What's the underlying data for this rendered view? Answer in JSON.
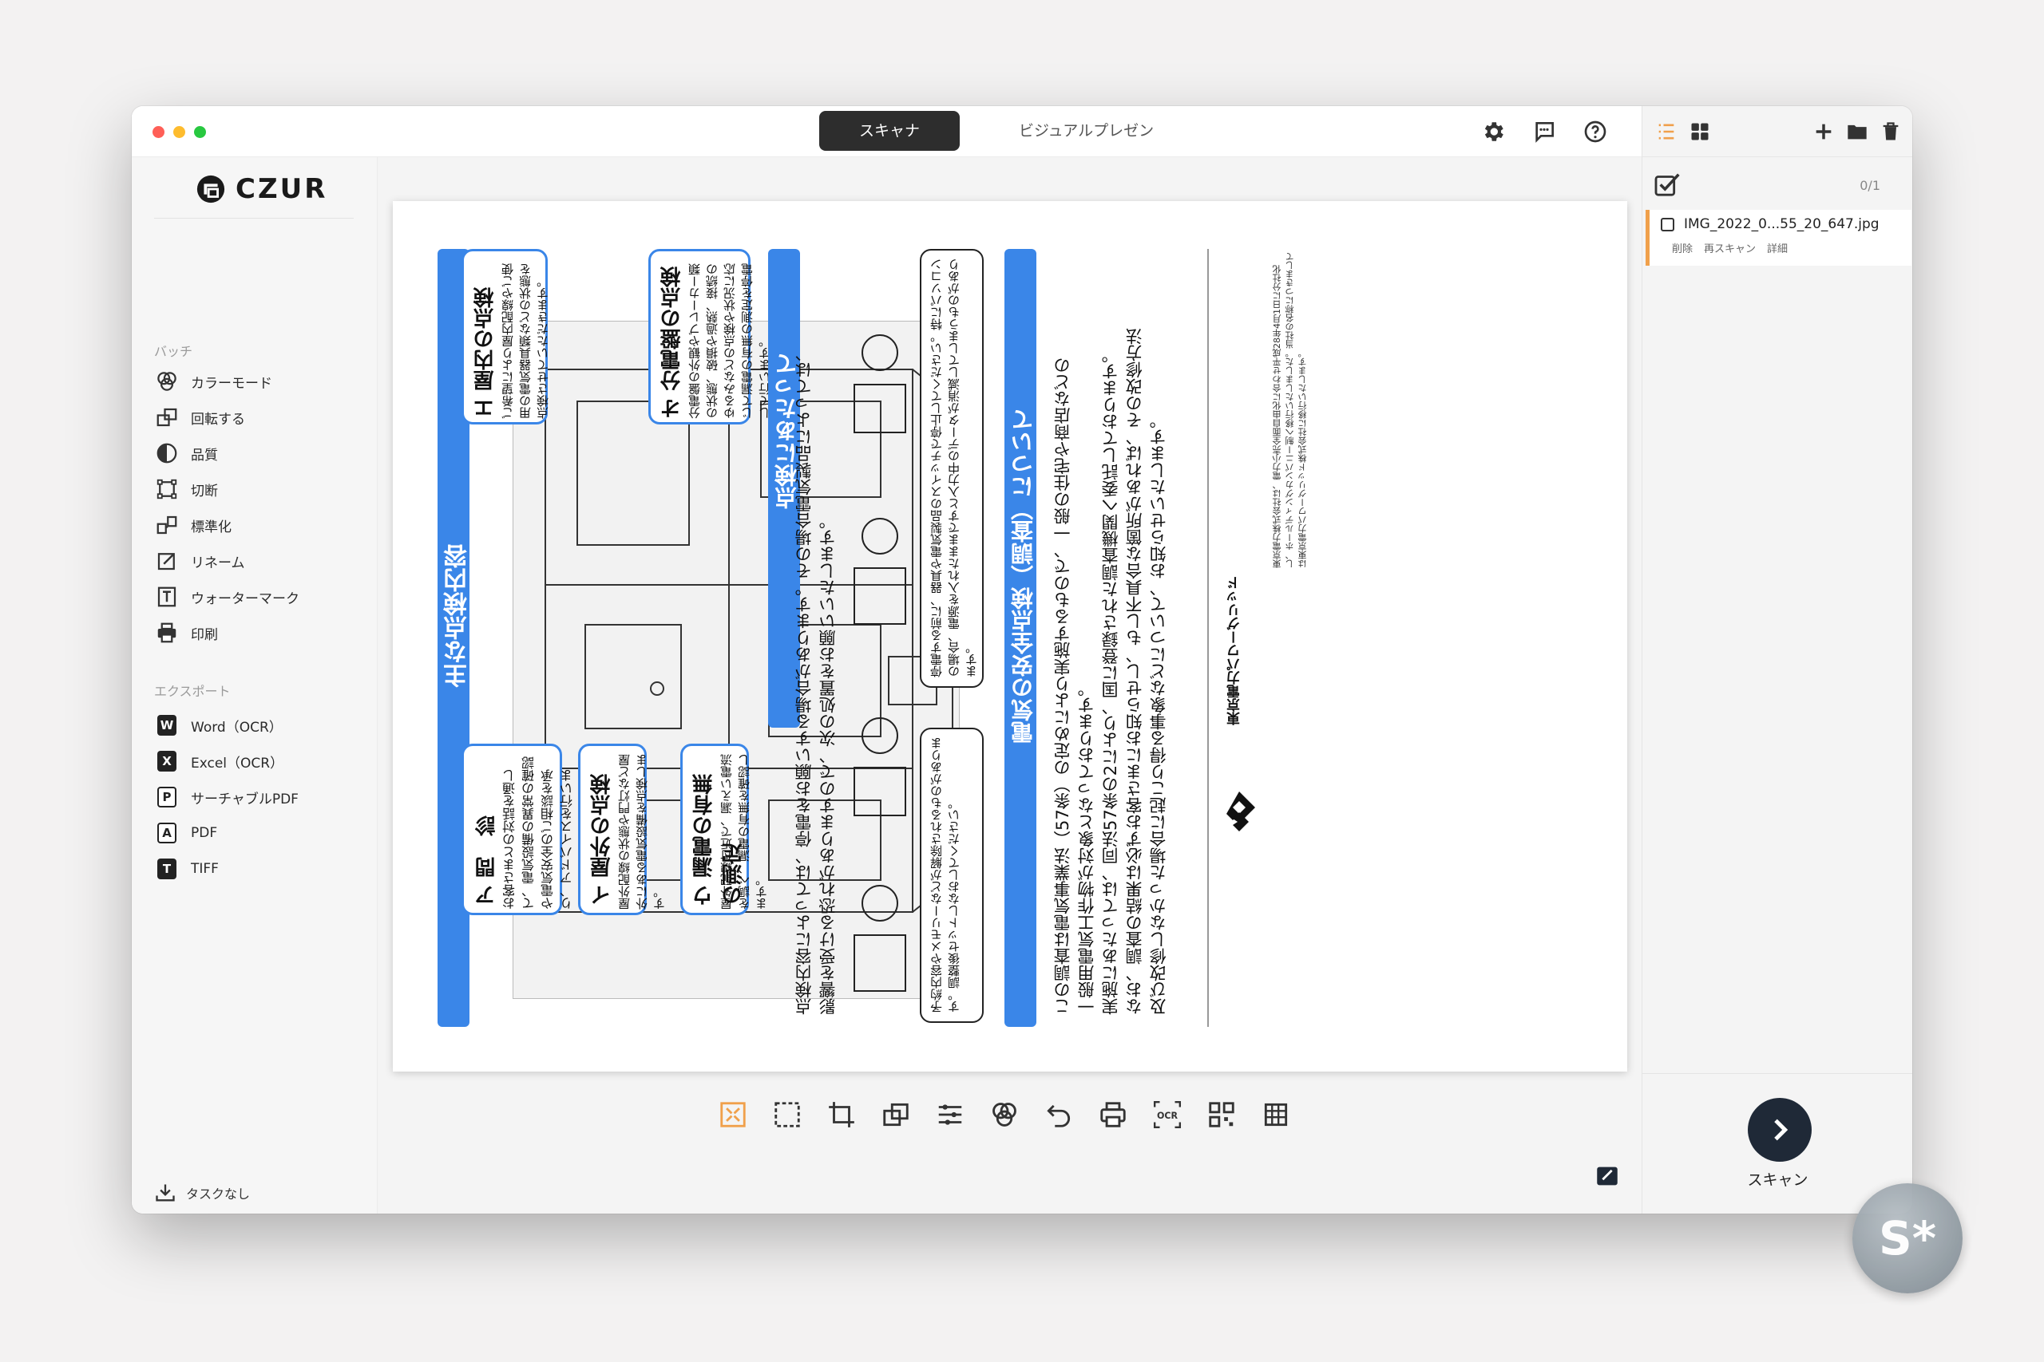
{
  "window": {
    "tabs": [
      {
        "label": "スキャナ",
        "active": true
      },
      {
        "label": "ビジュアルプレゼン",
        "active": false
      }
    ],
    "accent": "#2d2d2d",
    "highlight": "#f0a04b"
  },
  "sidebar": {
    "logo": "CZUR",
    "batch_label": "バッチ",
    "batch_items": [
      {
        "label": "カラーモード",
        "icon": "color-mode-icon"
      },
      {
        "label": "回転する",
        "icon": "rotate-icon"
      },
      {
        "label": "品質",
        "icon": "quality-icon"
      },
      {
        "label": "切断",
        "icon": "crop-icon"
      },
      {
        "label": "標準化",
        "icon": "normalize-icon"
      },
      {
        "label": "リネーム",
        "icon": "rename-icon"
      },
      {
        "label": "ウォーターマーク",
        "icon": "watermark-icon"
      },
      {
        "label": "印刷",
        "icon": "print-icon"
      }
    ],
    "export_label": "エクスポート",
    "export_items": [
      {
        "label": "Word（OCR）",
        "badge": "W"
      },
      {
        "label": "Excel（OCR）",
        "badge": "X"
      },
      {
        "label": "サーチャブルPDF",
        "badge": "P"
      },
      {
        "label": "PDF",
        "badge": "A"
      },
      {
        "label": "TIFF",
        "badge": "T"
      }
    ],
    "task_label": "タスクなし"
  },
  "document": {
    "title_main": "主な点検内容",
    "items": {
      "a_title": "ア 問　診",
      "a_body": "お客さまとの対話を通して、電気設備の異常の確認や電気安全のご相談を承り、アドバイスを行います。",
      "i_title": "イ 屋外の点検",
      "i_body": "屋外配線の状態や門灯など屋外にある電気設備を点検します。",
      "u_title": "ウ 漏電の有無の測定",
      "u_body": "屋外配線付近で、漏えい電流を調べ、漏電の有無を確認します。",
      "e_title": "エ 屋内の点検",
      "e_body": "ご希望により屋内配線やご使用の電気器具類などの状態を点検させていただきます。",
      "o_title": "オ 分電盤の点検",
      "o_body": "分電盤の外観やブレーカー類の状態、破損や過熱、接続のゆるみなどの点検や状況に応じて漏電の有無の測定を停電して行います。"
    },
    "notice_title": "点検にあたって",
    "notice_body_1": "点検内容によっては、停電をお願いする場合があります。その場合電気製品によっては、",
    "notice_body_2": "影響を受ける恐れがありますので、次の処置をお願いいたします。",
    "note_left": "予約内容やメモリーなどが解除されるものがあります。調整後セットしなおしてください。",
    "note_right": "停電する前に、器具や電気製品のスイッチで停止してください。特にパソコンの場合、電源を入れたままですと入力中のデータが消滅してしまうものがあります。",
    "safety_title": "電気の安全点検（調査）について",
    "safety_body_1": "この調査は電気事業法（57条）の定めにより実施するもので、一般の住宅や商店などの",
    "safety_body_2": "一般用電気工作物が対象となっております。",
    "safety_body_3": "実施にあたっては、同法57条の2により、国に登録された調査機関へ委託しております。",
    "safety_body_4": "なお、調査の結果は必ずお客さまにお知らせし、もし不具合な箇所があれば、その改修方法",
    "safety_body_5": "及び改修しなかった場合に起こり得る事象などについて、お知らせいたします。",
    "company": "東京電力パワーグリッド",
    "footnote": "東京電力株式会社は、電力小売全面自由化に合わせ平成28年4月1日に分社化し、ホールディングカンパニー制へ移行いたしました。当社の名称につきましては東京電力パワーグリッド株式会社に移行いたします。"
  },
  "toolbar": {
    "tools": [
      "fit-icon",
      "select-icon",
      "crop-icon",
      "rotate-page-icon",
      "adjust-icon",
      "color-icon",
      "undo-icon",
      "print-icon",
      "ocr-icon",
      "qr-icon",
      "grid-icon"
    ]
  },
  "right_panel": {
    "count": "0/1",
    "file_name": "IMG_2022_0...55_20_647.jpg",
    "actions": [
      "削除",
      "再スキャン",
      "詳細"
    ],
    "scan_label": "スキャン"
  },
  "floating_badge": "S*"
}
